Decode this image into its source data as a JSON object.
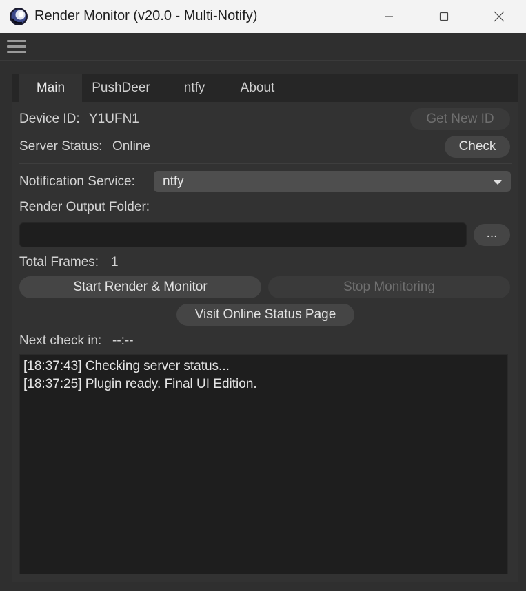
{
  "window": {
    "title": "Render Monitor (v20.0 - Multi-Notify)",
    "icon": "cinema4d-app-icon"
  },
  "tabs": [
    {
      "label": "Main",
      "active": true
    },
    {
      "label": "PushDeer",
      "active": false
    },
    {
      "label": "ntfy",
      "active": false
    },
    {
      "label": "About",
      "active": false
    }
  ],
  "main": {
    "device_id_label": "Device ID:",
    "device_id_value": "Y1UFN1",
    "get_new_id_label": "Get New ID",
    "server_status_label": "Server Status:",
    "server_status_value": "Online",
    "check_label": "Check",
    "notification_service_label": "Notification Service:",
    "notification_service_value": "ntfy",
    "render_output_folder_label": "Render Output Folder:",
    "render_output_folder_value": "",
    "browse_label": "...",
    "total_frames_label": "Total Frames:",
    "total_frames_value": "1",
    "start_label": "Start Render & Monitor",
    "stop_label": "Stop Monitoring",
    "visit_label": "Visit Online Status Page",
    "next_check_label": "Next check in:",
    "next_check_value": "--:--"
  },
  "log": [
    "[18:37:43] Checking server status...",
    "[18:37:25] Plugin ready. Final UI Edition."
  ],
  "colors": {
    "background": "#2f2f2f",
    "panel": "#323232",
    "button": "#454545",
    "log_background": "#1e1e1e"
  }
}
